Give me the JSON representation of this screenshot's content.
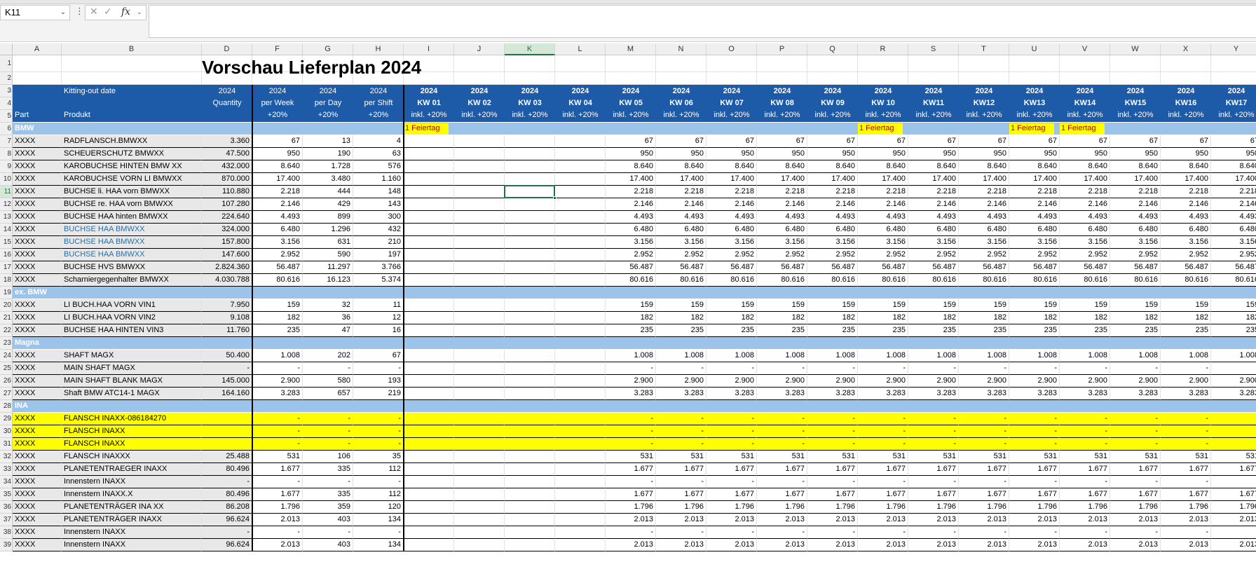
{
  "namebox": {
    "value": "K11"
  },
  "formula": {
    "x_icon": "cancel-icon",
    "check_icon": "enter-icon",
    "fx_label": "fx",
    "value": ""
  },
  "columns": [
    "A",
    "B",
    "D",
    "F",
    "G",
    "H",
    "I",
    "J",
    "K",
    "L",
    "M",
    "N",
    "O",
    "P",
    "Q",
    "R",
    "S",
    "T",
    "U",
    "V",
    "W",
    "X",
    "Y"
  ],
  "selected_column": "K",
  "selected_row": 11,
  "title": "Vorschau Lieferplan 2024",
  "header": {
    "part": "Part",
    "kitting": "Kitting-out date",
    "produkt": "Produkt",
    "qty": [
      "2024",
      "Quantity"
    ],
    "week": [
      "2024",
      "per Week",
      "+20%"
    ],
    "day": [
      "2024",
      "per Day",
      "+20%"
    ],
    "shift": [
      "2024",
      "per Shift",
      "+20%"
    ],
    "kw": [
      "KW 01",
      "KW 02",
      "KW 03",
      "KW 04",
      "KW 05",
      "KW 06",
      "KW 07",
      "KW 08",
      "KW 09",
      "KW 10",
      "KW11",
      "KW12",
      "KW13",
      "KW14",
      "KW15",
      "KW16",
      "KW17"
    ],
    "kw_year": "2024",
    "kw_sub": "inkl. +20%"
  },
  "feiertag_label": "1 Feiertag",
  "feiertag_cols": [
    0,
    9,
    12,
    13
  ],
  "rows": [
    {
      "r": 6,
      "type": "section",
      "label": "BMW"
    },
    {
      "r": 7,
      "a": "XXXX",
      "b": "RADFLANSCH.BMWXX",
      "d": "3.360",
      "f": "67",
      "g": "13",
      "h": "4",
      "kw": "67"
    },
    {
      "r": 8,
      "a": "XXXX",
      "b": "SCHEUERSCHUTZ BMWXX",
      "d": "47.500",
      "f": "950",
      "g": "190",
      "h": "63",
      "kw": "950"
    },
    {
      "r": 9,
      "a": "XXXX",
      "b": "KAROBUCHSE HINTEN BMW XX",
      "d": "432.000",
      "f": "8.640",
      "g": "1.728",
      "h": "576",
      "kw": "8.640"
    },
    {
      "r": 10,
      "a": "XXXX",
      "b": "KAROBUCHSE VORN LI BMWXX",
      "d": "870.000",
      "f": "17.400",
      "g": "3.480",
      "h": "1.160",
      "kw": "17.400"
    },
    {
      "r": 11,
      "a": "XXXX",
      "b": "BUCHSE li. HAA vorn BMWXX",
      "d": "110.880",
      "f": "2.218",
      "g": "444",
      "h": "148",
      "kw": "2.218"
    },
    {
      "r": 12,
      "a": "XXXX",
      "b": "BUCHSE re. HAA vorn BMWXX",
      "d": "107.280",
      "f": "2.146",
      "g": "429",
      "h": "143",
      "kw": "2.146"
    },
    {
      "r": 13,
      "a": "XXXX",
      "b": "BUCHSE HAA hinten BMWXX",
      "d": "224.640",
      "f": "4.493",
      "g": "899",
      "h": "300",
      "kw": "4.493"
    },
    {
      "r": 14,
      "a": "XXXX",
      "b": "BUCHSE HAA BMWXX",
      "d": "324.000",
      "f": "6.480",
      "g": "1.296",
      "h": "432",
      "kw": "6.480",
      "blue": true
    },
    {
      "r": 15,
      "a": "XXXX",
      "b": "BUCHSE HAA BMWXX",
      "d": "157.800",
      "f": "3.156",
      "g": "631",
      "h": "210",
      "kw": "3.156",
      "blue": true
    },
    {
      "r": 16,
      "a": "XXXX",
      "b": "BUCHSE HAA BMWXX",
      "d": "147.600",
      "f": "2.952",
      "g": "590",
      "h": "197",
      "kw": "2.952",
      "blue": true
    },
    {
      "r": 17,
      "a": "XXXX",
      "b": "BUCHSE  HVS BMWXX",
      "d": "2.824.360",
      "f": "56.487",
      "g": "11.297",
      "h": "3.766",
      "kw": "56.487"
    },
    {
      "r": 18,
      "a": "XXXX",
      "b": "Scharniergegenhalter BMWXX",
      "d": "4.030.788",
      "f": "80.616",
      "g": "16.123",
      "h": "5.374",
      "kw": "80.616"
    },
    {
      "r": 19,
      "type": "section",
      "label": "ex. BMW"
    },
    {
      "r": 20,
      "a": "XXXX",
      "b": "LI BUCH.HAA VORN VIN1",
      "d": "7.950",
      "f": "159",
      "g": "32",
      "h": "11",
      "kw": "159"
    },
    {
      "r": 21,
      "a": "XXXX",
      "b": "LI BUCH.HAA VORN VIN2",
      "d": "9.108",
      "f": "182",
      "g": "36",
      "h": "12",
      "kw": "182"
    },
    {
      "r": 22,
      "a": "XXXX",
      "b": "BUCHSE HAA HINTEN VIN3",
      "d": "11.760",
      "f": "235",
      "g": "47",
      "h": "16",
      "kw": "235"
    },
    {
      "r": 23,
      "type": "section",
      "label": "Magna"
    },
    {
      "r": 24,
      "a": "XXXX",
      "b": "SHAFT               MAGX",
      "d": "50.400",
      "f": "1.008",
      "g": "202",
      "h": "67",
      "kw": "1.008"
    },
    {
      "r": 25,
      "a": "XXXX",
      "b": "MAIN SHAFT        MAGX",
      "d": "-",
      "f": "-",
      "g": "-",
      "h": "-",
      "kw": "-"
    },
    {
      "r": 26,
      "a": "XXXX",
      "b": "MAIN SHAFT BLANK   MAGX",
      "d": "145.000",
      "f": "2.900",
      "g": "580",
      "h": "193",
      "kw": "2.900"
    },
    {
      "r": 27,
      "a": "XXXX",
      "b": "Shaft BMW ATC14-1  MAGX",
      "d": "164.160",
      "f": "3.283",
      "g": "657",
      "h": "219",
      "kw": "3.283"
    },
    {
      "r": 28,
      "type": "section",
      "label": "INA"
    },
    {
      "r": 29,
      "a": "XXXX",
      "b": "FLANSCH INAXX-086184270",
      "d": "",
      "f": "-",
      "g": "-",
      "h": "-",
      "kw": "-",
      "yellow": true
    },
    {
      "r": 30,
      "a": "XXXX",
      "b": "FLANSCH INAXX",
      "d": "",
      "f": "-",
      "g": "-",
      "h": "-",
      "kw": "-",
      "yellow": true
    },
    {
      "r": 31,
      "a": "XXXX",
      "b": "FLANSCH INAXX",
      "d": "",
      "f": "-",
      "g": "-",
      "h": "-",
      "kw": "-",
      "yellow": true
    },
    {
      "r": 32,
      "a": "XXXX",
      "b": "FLANSCH INAXXX",
      "d": "25.488",
      "f": "531",
      "g": "106",
      "h": "35",
      "kw": "531"
    },
    {
      "r": 33,
      "a": "XXXX",
      "b": "PLANETENTRAEGER INAXX",
      "d": "80.496",
      "f": "1.677",
      "g": "335",
      "h": "112",
      "kw": "1.677"
    },
    {
      "r": 34,
      "a": "XXXX",
      "b": "Innenstern INAXX",
      "d": "-",
      "f": "-",
      "g": "-",
      "h": "-",
      "kw": "-"
    },
    {
      "r": 35,
      "a": "XXXX",
      "b": "Innenstern INAXX.X",
      "d": "80.496",
      "f": "1.677",
      "g": "335",
      "h": "112",
      "kw": "1.677"
    },
    {
      "r": 36,
      "a": "XXXX",
      "b": "PLANETENTRÄGER INA XX",
      "d": "86.208",
      "f": "1.796",
      "g": "359",
      "h": "120",
      "kw": "1.796"
    },
    {
      "r": 37,
      "a": "XXXX",
      "b": "PLANETENTRÄGER INAXX",
      "d": "96.624",
      "f": "2.013",
      "g": "403",
      "h": "134",
      "kw": "2.013"
    },
    {
      "r": 38,
      "a": "XXXX",
      "b": "Innenstern INAXX",
      "d": "-",
      "f": "-",
      "g": "-",
      "h": "-",
      "kw": "-"
    },
    {
      "r": 39,
      "a": "XXXX",
      "b": "Innenstern INAXX",
      "d": "96.624",
      "f": "2.013",
      "g": "403",
      "h": "134",
      "kw": "2.013"
    }
  ]
}
